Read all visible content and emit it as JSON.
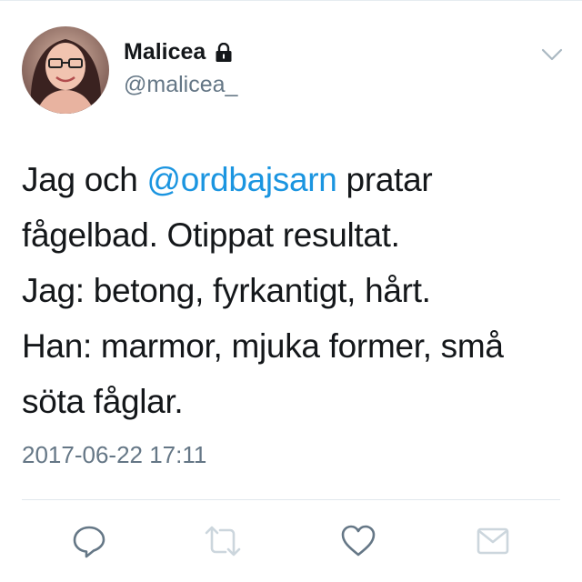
{
  "author": {
    "display_name": "Malicea",
    "handle": "@malicea_",
    "protected": true
  },
  "tweet": {
    "text_line1_pre": "Jag och ",
    "mention": "@ordbajsarn",
    "text_line1_post": " pratar",
    "text_line2": "fågelbad. Otippat resultat.",
    "text_line3": "Jag: betong, fyrkantigt, hårt.",
    "text_line4": "Han: marmor, mjuka former, små",
    "text_line5": "söta fåglar.",
    "timestamp": "2017-06-22 17:11"
  },
  "actions": [
    {
      "name": "reply",
      "icon": "reply-icon"
    },
    {
      "name": "retweet",
      "icon": "retweet-icon",
      "disabled": true
    },
    {
      "name": "like",
      "icon": "heart-icon"
    },
    {
      "name": "direct-message",
      "icon": "envelope-icon",
      "disabled": true
    }
  ],
  "colors": {
    "text": "#14171a",
    "secondary": "#657786",
    "link": "#1b95e0",
    "icon": "#657786",
    "icon_disabled": "#ccd6dd",
    "divider": "#e1e8ed"
  }
}
